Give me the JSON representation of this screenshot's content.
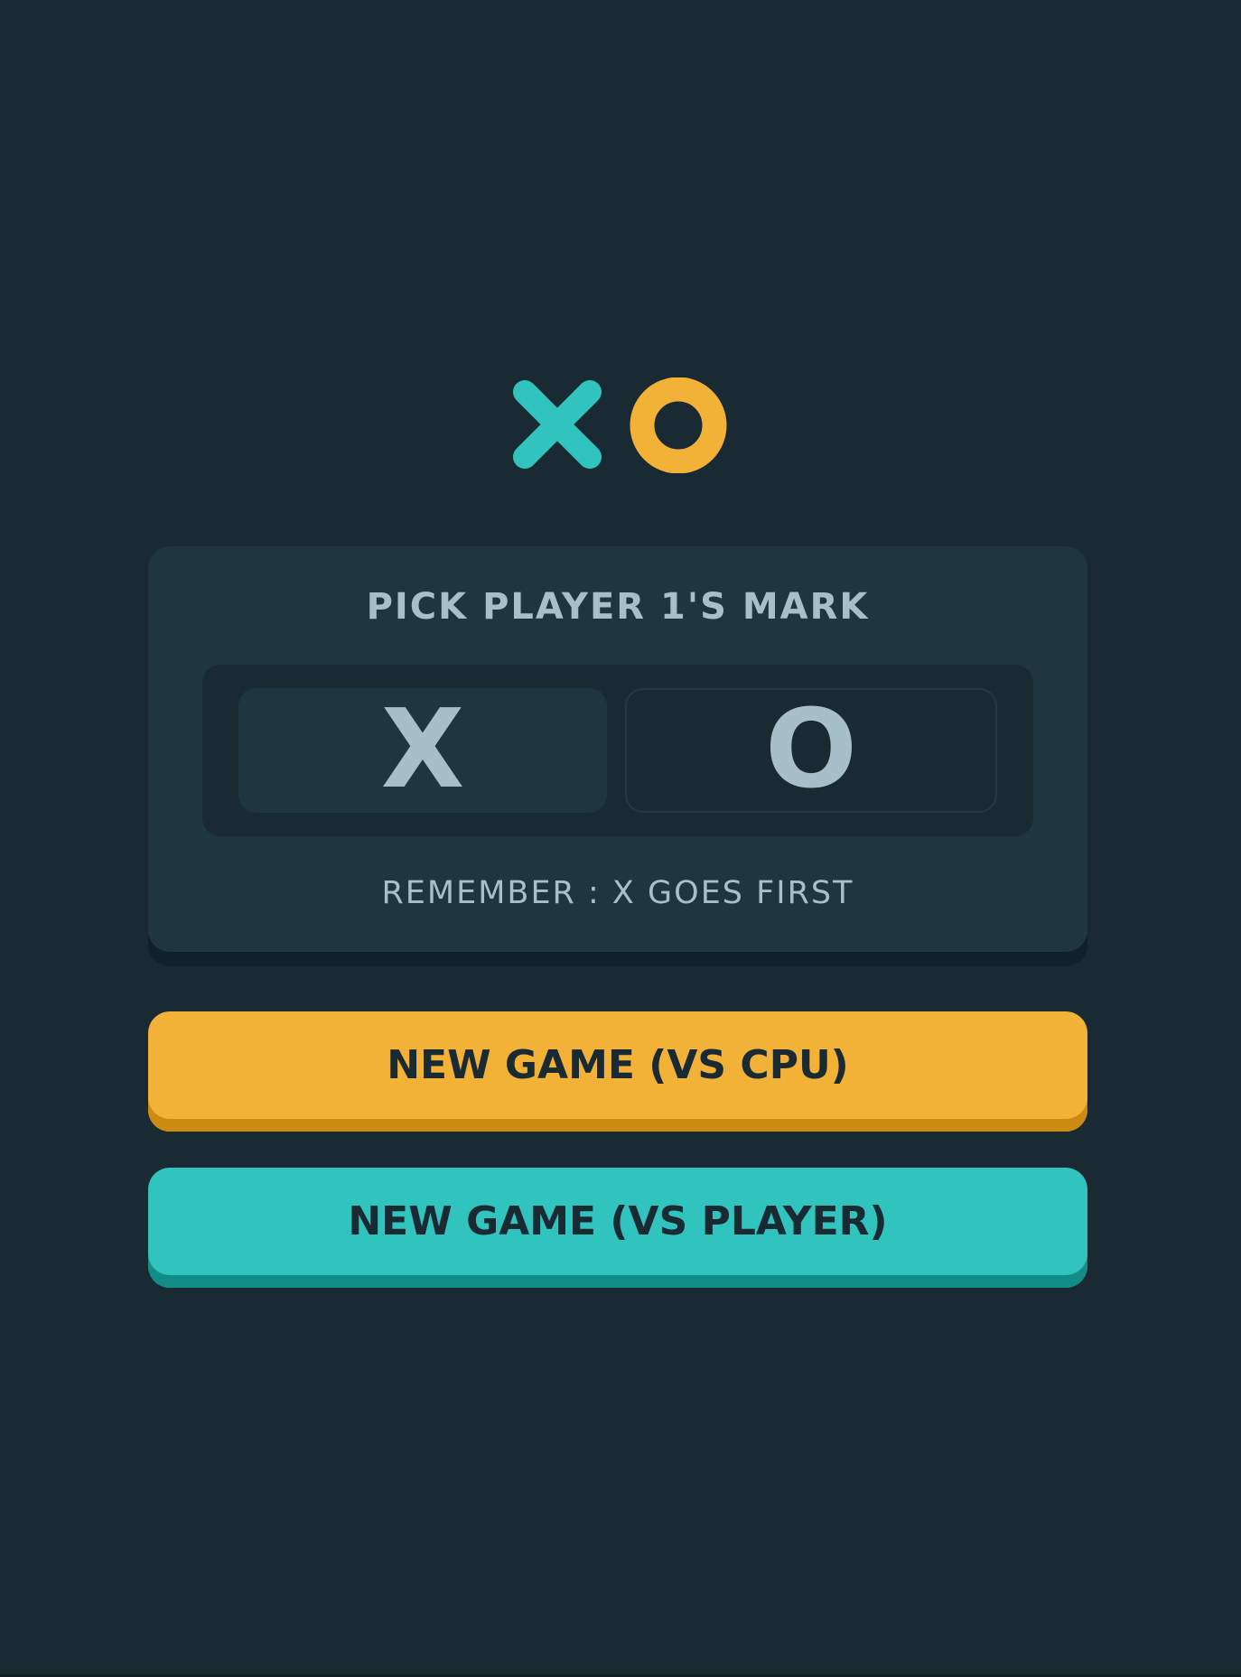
{
  "app": {
    "logo": {
      "icons": [
        "x-mark-icon",
        "o-mark-icon"
      ],
      "x_color": "#31C3BD",
      "o_color": "#F2B137"
    }
  },
  "pick_panel": {
    "title": "PICK PLAYER 1'S MARK",
    "options": [
      {
        "label": "X",
        "selected": true
      },
      {
        "label": "O",
        "selected": false
      }
    ],
    "hint": "REMEMBER : X GOES FIRST"
  },
  "buttons": {
    "vs_cpu": "NEW GAME (VS CPU)",
    "vs_player": "NEW GAME (VS PLAYER)"
  },
  "colors": {
    "background": "#1A2A33",
    "panel": "#1F3641",
    "text_muted": "#A8BFC9",
    "yellow": "#F2B137",
    "teal": "#31C3BD"
  }
}
